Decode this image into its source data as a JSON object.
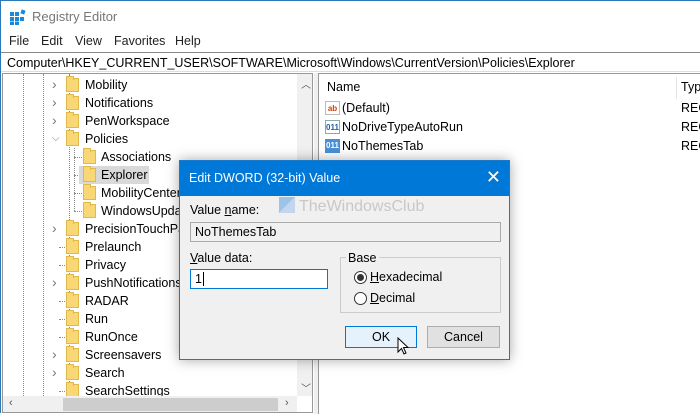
{
  "window": {
    "title": "Registry Editor"
  },
  "menu": [
    "File",
    "Edit",
    "View",
    "Favorites",
    "Help"
  ],
  "address": "Computer\\HKEY_CURRENT_USER\\SOFTWARE\\Microsoft\\Windows\\CurrentVersion\\Policies\\Explorer",
  "tree": [
    {
      "label": "Mobility",
      "level": 1,
      "expander": "collapsed"
    },
    {
      "label": "Notifications",
      "level": 1,
      "expander": "collapsed"
    },
    {
      "label": "PenWorkspace",
      "level": 1,
      "expander": "collapsed"
    },
    {
      "label": "Policies",
      "level": 1,
      "expander": "expanded"
    },
    {
      "label": "Associations",
      "level": 2,
      "expander": "none"
    },
    {
      "label": "Explorer",
      "level": 2,
      "expander": "none",
      "selected": true
    },
    {
      "label": "MobilityCenter",
      "level": 2,
      "expander": "none"
    },
    {
      "label": "WindowsUpdate",
      "level": 2,
      "expander": "none"
    },
    {
      "label": "PrecisionTouchPad",
      "level": 1,
      "expander": "collapsed"
    },
    {
      "label": "Prelaunch",
      "level": 1,
      "expander": "none"
    },
    {
      "label": "Privacy",
      "level": 1,
      "expander": "none"
    },
    {
      "label": "PushNotifications",
      "level": 1,
      "expander": "collapsed"
    },
    {
      "label": "RADAR",
      "level": 1,
      "expander": "none"
    },
    {
      "label": "Run",
      "level": 1,
      "expander": "none"
    },
    {
      "label": "RunOnce",
      "level": 1,
      "expander": "none"
    },
    {
      "label": "Screensavers",
      "level": 1,
      "expander": "collapsed"
    },
    {
      "label": "Search",
      "level": 1,
      "expander": "collapsed"
    },
    {
      "label": "SearchSettings",
      "level": 1,
      "expander": "none"
    }
  ],
  "values": {
    "columns": {
      "name": "Name",
      "type": "Type"
    },
    "rows": [
      {
        "name": "(Default)",
        "type": "REG",
        "icon": "string-value-icon"
      },
      {
        "name": "NoDriveTypeAutoRun",
        "type": "REG",
        "icon": "dword-value-icon"
      },
      {
        "name": "NoThemesTab",
        "type": "REG",
        "icon": "dword-value-icon"
      }
    ]
  },
  "dialog": {
    "title": "Edit DWORD (32-bit) Value",
    "close": "✕",
    "value_name_label_a": "Value ",
    "value_name_label_u": "n",
    "value_name_label_b": "ame:",
    "value_name": "NoThemesTab",
    "value_data_label_u": "V",
    "value_data_label_b": "alue data:",
    "value_data": "1",
    "base_label": "Base",
    "hex_u": "H",
    "hex_rest": "exadecimal",
    "dec_u": "D",
    "dec_rest": "ecimal",
    "selected_base": "Hexadecimal",
    "ok": "OK",
    "cancel": "Cancel",
    "watermark": "TheWindowsClub"
  },
  "colors": {
    "accent": "#0078d7"
  }
}
